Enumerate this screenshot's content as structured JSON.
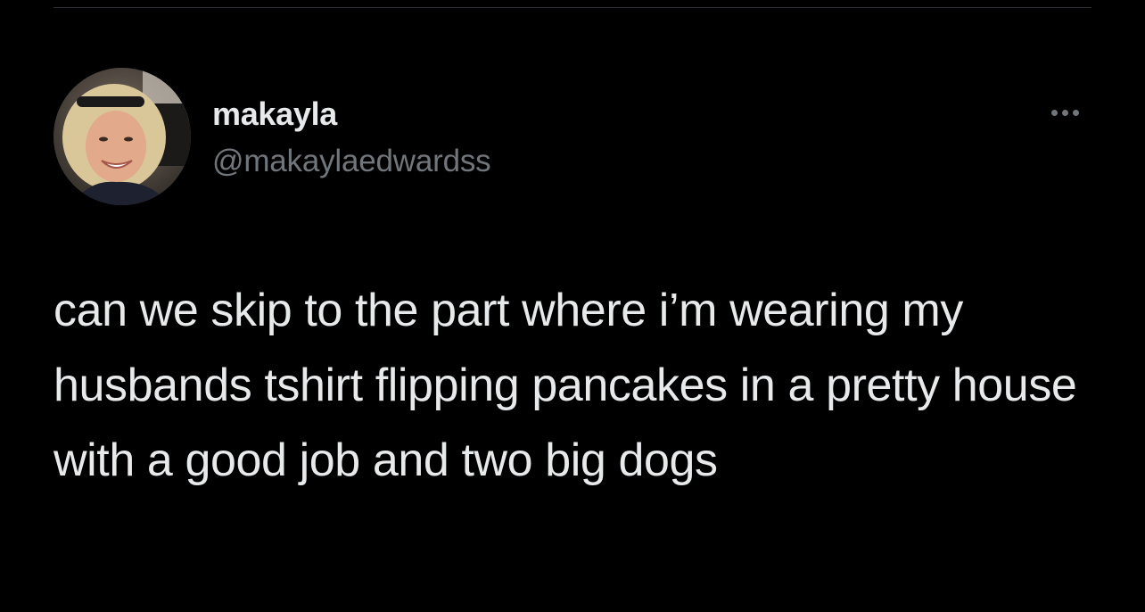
{
  "tweet": {
    "author": {
      "display_name": "makayla",
      "handle": "@makaylaedwardss",
      "avatar_icon": "profile-photo"
    },
    "more_icon": "more-horizontal-icon",
    "text": "can we skip to the part where i’m wearing my husbands tshirt flipping pancakes in a pretty house with a good job and two big dogs"
  },
  "theme": {
    "background": "#000000",
    "text_primary": "#e7e9ea",
    "text_secondary": "#71767b",
    "divider": "#2f3336"
  }
}
